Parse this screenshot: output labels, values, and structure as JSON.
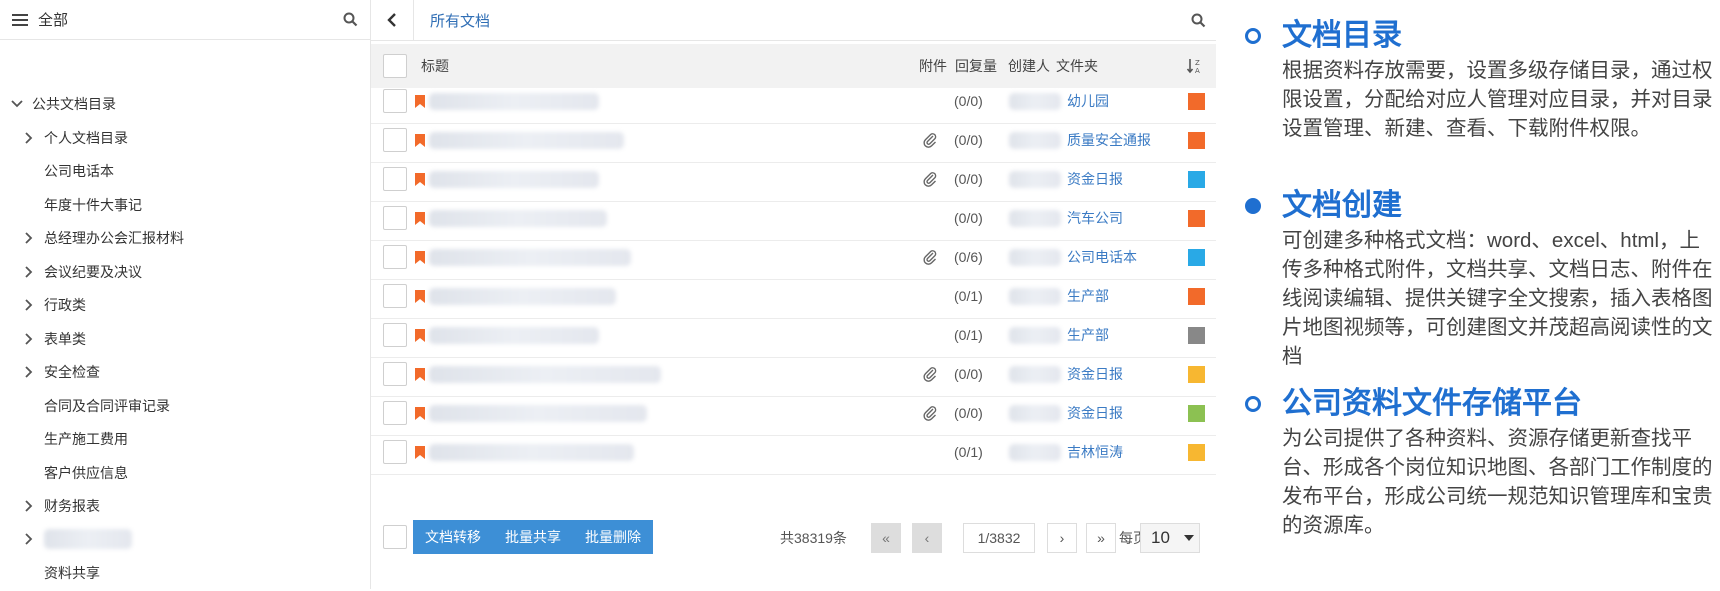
{
  "sidebar": {
    "title": "全部",
    "items": [
      {
        "label": "公共文档目录",
        "arrow": "down",
        "level": 0
      },
      {
        "label": "个人文档目录",
        "arrow": "right",
        "level": 1
      },
      {
        "label": "公司电话本",
        "arrow": "none",
        "level": 1
      },
      {
        "label": "年度十件大事记",
        "arrow": "none",
        "level": 1
      },
      {
        "label": "总经理办公会汇报材料",
        "arrow": "right",
        "level": 1
      },
      {
        "label": "会议纪要及决议",
        "arrow": "right",
        "level": 1
      },
      {
        "label": "行政类",
        "arrow": "right",
        "level": 1
      },
      {
        "label": "表单类",
        "arrow": "right",
        "level": 1
      },
      {
        "label": "安全检查",
        "arrow": "right",
        "level": 1
      },
      {
        "label": "合同及合同评审记录",
        "arrow": "none",
        "level": 1
      },
      {
        "label": "生产施工费用",
        "arrow": "none",
        "level": 1
      },
      {
        "label": "客户供应信息",
        "arrow": "none",
        "level": 1
      },
      {
        "label": "财务报表",
        "arrow": "right",
        "level": 1
      },
      {
        "label": "",
        "arrow": "right",
        "level": 1,
        "blurred": true
      },
      {
        "label": "资料共享",
        "arrow": "none",
        "level": 1
      }
    ]
  },
  "main": {
    "breadcrumb": "所有文档",
    "columns": {
      "title": "标题",
      "attachment": "附件",
      "replies": "回复量",
      "creator": "创建人",
      "folder": "文件夹"
    },
    "rows": [
      {
        "attachment": false,
        "replies": "(0/0)",
        "folder": "幼儿园",
        "color": "#f26a2a"
      },
      {
        "attachment": true,
        "replies": "(0/0)",
        "folder": "质量安全通报",
        "color": "#f26a2a"
      },
      {
        "attachment": true,
        "replies": "(0/0)",
        "folder": "资金日报",
        "color": "#29a9e6"
      },
      {
        "attachment": false,
        "replies": "(0/0)",
        "folder": "汽车公司",
        "color": "#f26a2a"
      },
      {
        "attachment": true,
        "replies": "(0/6)",
        "folder": "公司电话本",
        "color": "#29a9e6"
      },
      {
        "attachment": false,
        "replies": "(0/1)",
        "folder": "生产部",
        "color": "#f26a2a"
      },
      {
        "attachment": false,
        "replies": "(0/1)",
        "folder": "生产部",
        "color": "#888888"
      },
      {
        "attachment": true,
        "replies": "(0/0)",
        "folder": "资金日报",
        "color": "#f7b731"
      },
      {
        "attachment": true,
        "replies": "(0/0)",
        "folder": "资金日报",
        "color": "#8cc152"
      },
      {
        "attachment": false,
        "replies": "(0/1)",
        "folder": "吉林恒涛",
        "color": "#f7b731"
      }
    ],
    "actions": {
      "transfer": "文档转移",
      "share": "批量共享",
      "delete": "批量删除"
    },
    "pagination": {
      "total": "共38319条",
      "first": "«",
      "prev": "‹",
      "page": "1/3832",
      "next": "›",
      "last": "»",
      "per_page_label": "每页",
      "per_page": "10"
    }
  },
  "promo": [
    {
      "marker": "ring",
      "heading": "文档目录",
      "body": "根据资料存放需要，设置多级存储目录，通过权限设置，分配给对应人管理对应目录，并对目录设置管理、新建、查看、下载附件权限。"
    },
    {
      "marker": "dot",
      "heading": "文档创建",
      "body": "可创建多种格式文档：word、excel、html，上传多种格式附件，文档共享、文档日志、附件在线阅读编辑、提供关键字全文搜索，插入表格图片地图视频等，可创建图文并茂超高阅读性的文档"
    },
    {
      "marker": "ring",
      "heading": "公司资料文件存储平台",
      "body": "为公司提供了各种资料、资源存储更新查找平台、形成各个岗位知识地图、各部门工作制度的发布平台，形成公司统一规范知识管理库和宝贵的资源库。"
    }
  ],
  "icons": {
    "menu": "hamburger-icon",
    "search": "search-icon",
    "back": "chevron-left-icon",
    "sort": "sort-az-icon",
    "flag": "bookmark-flag-icon",
    "attachment": "paperclip-icon"
  }
}
